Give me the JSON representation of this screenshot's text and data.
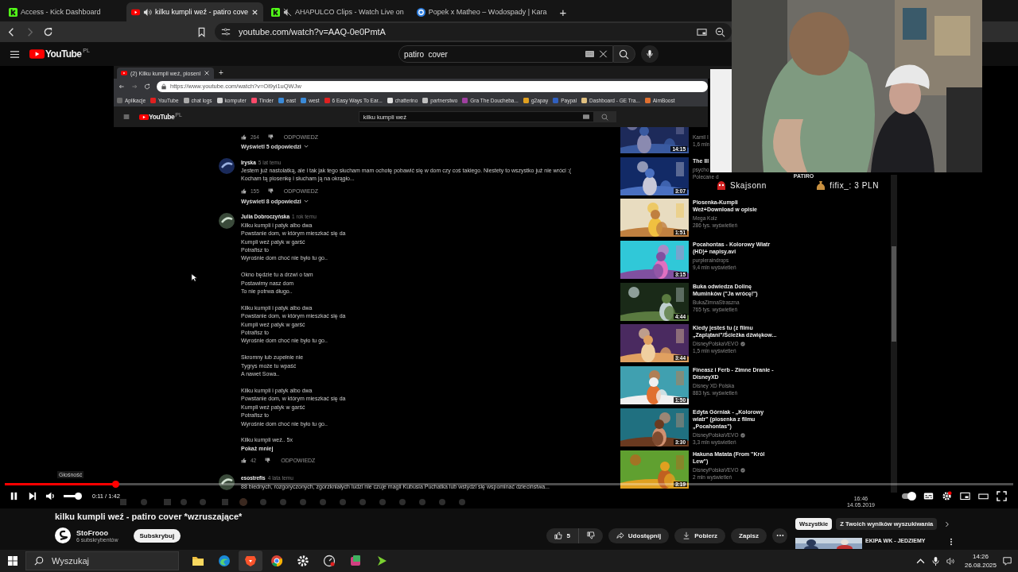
{
  "tabs": [
    {
      "title": "Access - Kick Dashboard",
      "kind": "kick",
      "playing": false,
      "muted": false,
      "selected": false
    },
    {
      "title": "kilku kumpli weź - patiro cove",
      "kind": "video",
      "playing": true,
      "muted": false,
      "selected": true
    },
    {
      "title": "AHAPULCO Clips - Watch Live on",
      "kind": "kick",
      "playing": false,
      "muted": true,
      "selected": false
    },
    {
      "title": "Popek x Matheo – Wodospady | Kara",
      "kind": "round",
      "playing": false,
      "muted": false,
      "selected": false
    }
  ],
  "new_tab": "+",
  "address": "youtube.com/watch?v=AAQ-0e0PmtA",
  "youtube": {
    "logo": "YouTube",
    "region": "PL",
    "search": "patiro  cover"
  },
  "video": {
    "inner": {
      "tab": "(2) Kilku kumpli weź, piosenl",
      "new_tab": "+",
      "url": "https://www.youtube.com/watch?v=Ol9yi1uQWJw",
      "bookmarks": [
        "Aplikacje",
        "YouTube",
        "chat logs",
        "komputer",
        "Tinder",
        "east",
        "west",
        "6 Easy Ways To Ear...",
        "chatterino",
        "partnerstwo",
        "Gra The Doucheba...",
        "g2apay",
        "Paypal",
        "Dashboard - GE Tra...",
        "AimBoost"
      ],
      "logo": "YouTube",
      "region": "PL",
      "search": "kilku kumpli weź",
      "comments": [
        {
          "likes": "264",
          "reply": "ODPOWIEDZ",
          "replies_link": "Wyświetl 5 odpowiedzi"
        },
        {
          "author": "Iryska",
          "time": "5 lat temu",
          "stanzas": [
            [
              "Jestem już nastolatką, ale i tak jak tego słucham mam ochotę pobawić się w dom czy coś takiego. Niestety to wszystko już nie wróci :(",
              "Kocham tą piosenkę i słucham ją na okrągło..."
            ]
          ],
          "likes": "155",
          "reply": "ODPOWIEDZ",
          "replies_link": "Wyświetl 8 odpowiedzi"
        },
        {
          "author": "Julia Dobroczyńska",
          "time": "1 rok temu",
          "stanzas": [
            [
              "Kilku kumpli i patyk albo dwa",
              "Powstanie dom, w którym mieszkać się da",
              "Kumpli weź patyk w garść",
              "Potrafisz to",
              "Wyrośnie dom choć nie było tu go.."
            ],
            [
              "Okno będzie tu a drzwi o tam",
              "Postawimy nasz dom",
              "To nie potrwa długo.."
            ],
            [
              "Kilku kumpli i patyk albo dwa",
              "Powstanie dom, w którym mieszkać się da",
              "Kumpli weź patyk w garść",
              "Potrafisz to",
              "Wyrośnie dom choć nie było tu go.."
            ],
            [
              "Skromny lub zupełnie nie",
              "Tygrys może tu wpaść",
              "A nawet Sowa.."
            ],
            [
              "Kilku kumpli i patyk albo dwa",
              "Powstanie dom, w którym mieszkać się da",
              "Kumpli weź patyk w garść",
              "Potrafisz to",
              "Wyrośnie dom choć nie było tu go.."
            ],
            [
              "Kilku kumpli weź.. 5x"
            ]
          ],
          "show_less": "Pokaż mniej",
          "likes": "42",
          "reply": "ODPOWIEDZ"
        },
        {
          "author": "esostrefis",
          "time": "4 lata temu",
          "stanzas": [
            [
              "88 biednych, rozgoryczonych, zgorzkniałych ludzi nie czuje magii Kubusia Puchatka lub wstydzi się wspominać dzieciństwa..."
            ]
          ]
        }
      ],
      "sidebar": [
        {
          "channel": "Kamil I",
          "views": "1,6 mln",
          "duration": "14:15"
        },
        {
          "title": "The Ill",
          "channel": "psycho",
          "views": "Polecane d",
          "duration": "3:07"
        },
        {
          "title": "Piosenka-Kumpli Weż+Download w opisie",
          "channel": "Mega Kolz",
          "views": "286 tys. wyświetleń",
          "duration": "1:51",
          "verified": false
        },
        {
          "title": "Pocahontas - Kolorowy Wiatr (HD)+ napisy.avi",
          "channel": "purpleraindrops",
          "views": "9,4 mln wyświetleń",
          "duration": "3:15",
          "verified": false
        },
        {
          "title": "Buka odwiedza Dolinę Muminków (\"Ja wrócę!\")",
          "channel": "BukaZimnaStraszna",
          "views": "765 tys. wyświetleń",
          "duration": "4:44",
          "verified": false
        },
        {
          "title": "Kiedy jesteś tu (z filmu „Zaplątani\"/Ścieżka dźwiękow...",
          "channel": "DisneyPolskaVEVO",
          "views": "1,5 mln wyświetleń",
          "duration": "3:44",
          "verified": true
        },
        {
          "title": "Fineasz i Ferb - Zimne Dranie - DisneyXD",
          "channel": "Disney XD Polska",
          "views": "883 tys. wyświetleń",
          "duration": "1:50",
          "verified": false
        },
        {
          "title": "Edyta Górniak - „Kolorowy wiatr\" (piosenka z filmu „Pocahontas\")",
          "channel": "DisneyPolskaVEVO",
          "views": "3,3 mln wyświetleń",
          "duration": "3:30",
          "verified": true
        },
        {
          "title": "Hakuna Matata (From \"Król Lew\")",
          "channel": "DisneyPolskaVEVO",
          "views": "2 mln wyświetleń",
          "duration": "3:19",
          "verified": true
        }
      ],
      "taskbar_time": "16:46",
      "taskbar_date": "14.05.2019"
    },
    "chat": {
      "header": "PATIRO",
      "messages": [
        {
          "kind": "follow",
          "text": "Skajsonn"
        },
        {
          "kind": "donation",
          "text": "fifix_: 3 PLN"
        }
      ]
    },
    "player": {
      "tooltip": "Głośność",
      "level": 0.11,
      "volume": {
        "level": 0.9
      },
      "time": "0:11 / 1:42",
      "autoplay": true
    }
  },
  "title": "kilku kumpli weź - patiro cover *wzruszające*",
  "channel": {
    "name": "StoFrooo",
    "subscribers": "6 subskrybentów",
    "subscribe": "Subskrybuj"
  },
  "actions": {
    "likes": "5",
    "share": "Udostępnij",
    "download": "Pobierz",
    "save": "Zapisz"
  },
  "chips": [
    {
      "label": "Wszystkie",
      "selected": true
    },
    {
      "label": "Z Twoich wyników wyszukiwania",
      "selected": false
    }
  ],
  "up_next": {
    "title": "EKIPA WK - JEDZIEMY"
  },
  "taskbar": {
    "search": "Wyszukaj",
    "apps": [
      {
        "kind": "folder",
        "selected": false
      },
      {
        "kind": "edge",
        "selected": false
      },
      {
        "kind": "brave",
        "selected": true
      },
      {
        "kind": "chrome",
        "selected": false
      },
      {
        "kind": "settings",
        "selected": false
      },
      {
        "kind": "gauge",
        "selected": false
      },
      {
        "kind": "media",
        "selected": false
      },
      {
        "kind": "arrow",
        "selected": false
      }
    ],
    "time": "14:26",
    "date": "26.08.2025"
  }
}
